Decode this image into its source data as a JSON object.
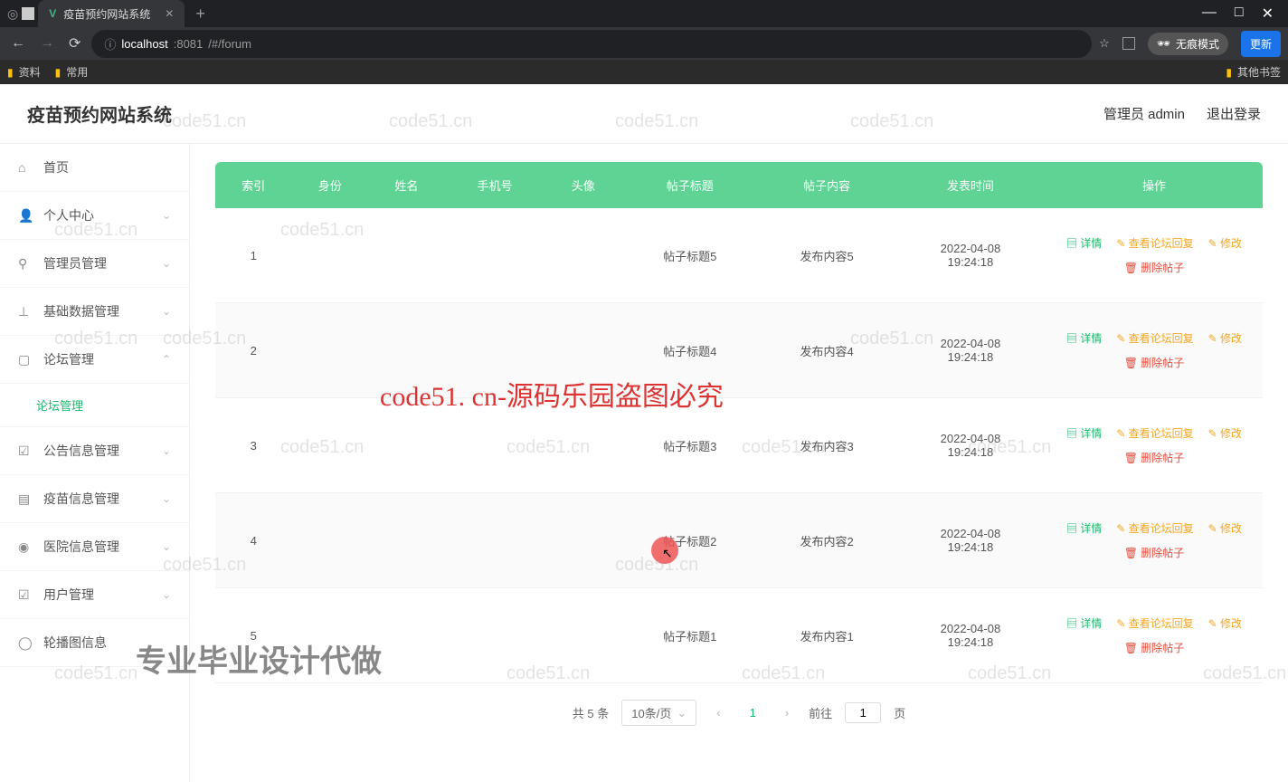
{
  "browser": {
    "tab_title": "疫苗预约网站系统",
    "url_prefix": "localhost",
    "url_port": ":8081",
    "url_path": "/#/forum",
    "incognito_label": "无痕模式",
    "update_label": "更新",
    "bookmarks": {
      "b1": "资料",
      "b2": "常用",
      "b_other": "其他书签"
    }
  },
  "header": {
    "title": "疫苗预约网站系统",
    "user_label": "管理员 admin",
    "logout": "退出登录"
  },
  "sidebar": {
    "home": "首页",
    "personal": "个人中心",
    "admin": "管理员管理",
    "basic": "基础数据管理",
    "forum": "论坛管理",
    "forum_sub": "论坛管理",
    "notice": "公告信息管理",
    "vaccine": "疫苗信息管理",
    "hospital": "医院信息管理",
    "user": "用户管理",
    "carousel": "轮播图信息"
  },
  "table": {
    "cols": {
      "index": "索引",
      "identity": "身份",
      "name": "姓名",
      "phone": "手机号",
      "avatar": "头像",
      "title": "帖子标题",
      "content": "帖子内容",
      "time": "发表时间",
      "op": "操作"
    },
    "ops": {
      "detail": "详情",
      "reply": "查看论坛回复",
      "edit": "修改",
      "delete": "删除帖子"
    },
    "rows": [
      {
        "idx": "1",
        "title": "帖子标题5",
        "content": "发布内容5",
        "time": "2022-04-08 19:24:18"
      },
      {
        "idx": "2",
        "title": "帖子标题4",
        "content": "发布内容4",
        "time": "2022-04-08 19:24:18"
      },
      {
        "idx": "3",
        "title": "帖子标题3",
        "content": "发布内容3",
        "time": "2022-04-08 19:24:18"
      },
      {
        "idx": "4",
        "title": "帖子标题2",
        "content": "发布内容2",
        "time": "2022-04-08 19:24:18"
      },
      {
        "idx": "5",
        "title": "帖子标题1",
        "content": "发布内容1",
        "time": "2022-04-08 19:24:18"
      }
    ]
  },
  "pagination": {
    "total": "共 5 条",
    "perpage": "10条/页",
    "current": "1",
    "goto_prefix": "前往",
    "goto_value": "1",
    "goto_suffix": "页"
  },
  "watermarks": {
    "red": "code51. cn-源码乐园盗图必究",
    "gray": "专业毕业设计代做",
    "wm": "code51.cn"
  }
}
